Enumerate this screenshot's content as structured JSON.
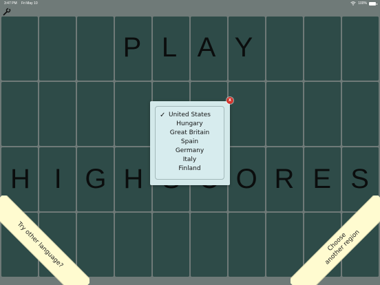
{
  "status_bar": {
    "time": "3:47 PM",
    "date": "Fri May 10",
    "wifi_icon": "wifi-icon",
    "battery_percent": "100%",
    "battery_level": 100
  },
  "toolbar": {
    "settings_icon": "wrench-icon"
  },
  "board": {
    "rows": 4,
    "cols": 10,
    "tile_color": "#2e4b48",
    "background_color": "#6f7a78"
  },
  "play_word": [
    "P",
    "L",
    "A",
    "Y"
  ],
  "highscores_word": [
    "H",
    "I",
    "G",
    "H",
    "S",
    "C",
    "O",
    "R",
    "E",
    "S"
  ],
  "region_picker": {
    "selected": "United States",
    "close_label": "x",
    "options": [
      "United States",
      "Hungary",
      "Great Britain",
      "Spain",
      "Germany",
      "Italy",
      "Finland"
    ]
  },
  "corners": {
    "left_text": "Try other language?",
    "right_text": "Choose another region",
    "color": "#fffbd0"
  }
}
